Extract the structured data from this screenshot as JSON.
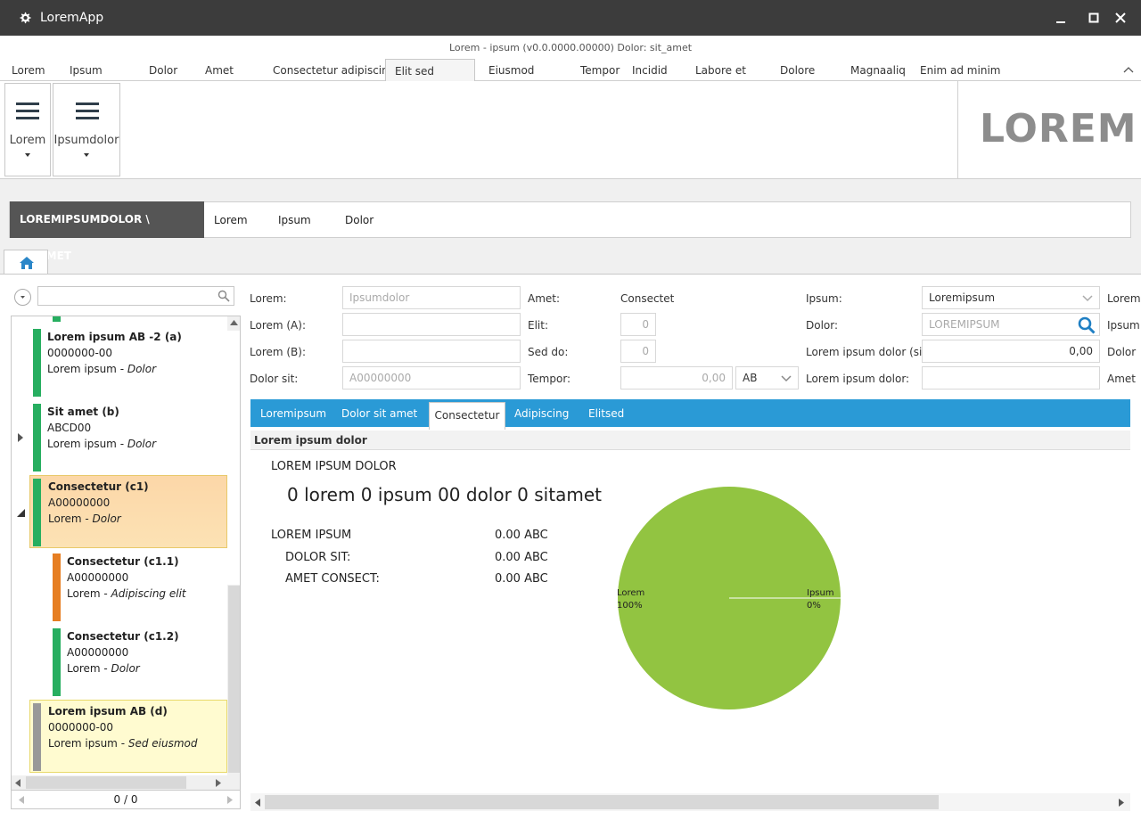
{
  "window": {
    "title": "LoremApp",
    "subtitle": "Lorem - ipsum (v0.0.0000.00000) Dolor: sit_amet"
  },
  "menu": {
    "items": [
      "Lorem",
      "Ipsum",
      "Dolor",
      "Amet",
      "Consectetur adipiscing",
      "Elit sed",
      "Eiusmod",
      "Tempor",
      "Incidid",
      "Labore et",
      "Dolore",
      "Magnaaliq",
      "Enim ad minim"
    ],
    "active_index": 5
  },
  "ribbon": {
    "btn1_label": "Lorem",
    "btn2_label": "Ipsumdolor",
    "brand": "LOREM"
  },
  "breadcrumb": {
    "title": "LOREMIPSUMDOLOR \\ SITAMET",
    "links": [
      "Lorem",
      "Ipsum",
      "Dolor"
    ]
  },
  "tree": {
    "items": [
      {
        "name": "Lorem ipsum AB -2  (a)",
        "code": "0000000-00",
        "type": "Lorem ipsum",
        "status": "Dolor",
        "color": "#27ae60"
      },
      {
        "name": "Sit amet  (b)",
        "code": "ABCD00",
        "type": "Lorem ipsum",
        "status": "Dolor",
        "color": "#27ae60"
      },
      {
        "name": "Consectetur  (c1)",
        "code": "A00000000",
        "type": "Lorem",
        "status": "Dolor",
        "color": "#27ae60"
      },
      {
        "name": "Consectetur  (c1.1)",
        "code": "A00000000",
        "type": "Lorem",
        "status": "Adipiscing elit",
        "color": "#e67e22"
      },
      {
        "name": "Consectetur  (c1.2)",
        "code": "A00000000",
        "type": "Lorem",
        "status": "Dolor",
        "color": "#27ae60"
      },
      {
        "name": "Lorem ipsum AB  (d)",
        "code": "0000000-00",
        "type": "Lorem ipsum",
        "status": "Sed eiusmod",
        "color": "#999999"
      }
    ],
    "pager": "0 / 0"
  },
  "form": {
    "name_label": "Lorem:",
    "name_value": "Ipsumdolor",
    "name_a_label": "Lorem (A):",
    "name_i_label": "Lorem (B):",
    "ext_code_label": "Dolor sit:",
    "ext_code_value": "A00000000",
    "status_label": "Amet:",
    "status_value": "Consectet",
    "version_label": "Elit:",
    "version_value": "0",
    "priority_label": "Sed do:",
    "priority_value": "0",
    "quantity_label": "Tempor:",
    "quantity_value": "0,00",
    "unit_value": "AB",
    "type_label": "Ipsum:",
    "type_value": "Loremipsum",
    "stock_label": "Dolor:",
    "stock_value": "LOREMIPSUM",
    "overhead_label": "Lorem ipsum dolor (sit):",
    "overhead_value": "0,00",
    "min_serial_label": "Lorem ipsum dolor:",
    "right_cut_1": "Lorem",
    "right_cut_2": "Ipsum",
    "right_cut_3": "Dolor",
    "right_cut_4": "Amet"
  },
  "subtabs": {
    "items": [
      "Loremipsum",
      "Dolor sit amet",
      "Consectetur",
      "Adipiscing",
      "Elitsed"
    ],
    "active_index": 2
  },
  "section": {
    "title": "Lorem ipsum dolor",
    "duration_header": "LOREM IPSUM DOLOR",
    "duration_value": "0 lorem 0 ipsum 00 dolor 0 sitamet",
    "cost_header": "LOREM IPSUM",
    "cost_value": "0.00 ABC",
    "material_label": "DOLOR SIT:",
    "material_value": "0.00 ABC",
    "operation_label": "AMET CONSECT:",
    "operation_value": "0.00 ABC"
  },
  "chart_data": {
    "type": "pie",
    "slices": [
      {
        "label": "Lorem",
        "percent_label": "100%",
        "value": 100,
        "color": "#92c441"
      },
      {
        "label": "Ipsum",
        "percent_label": "0%",
        "value": 0,
        "color": "#ffffff"
      }
    ]
  }
}
